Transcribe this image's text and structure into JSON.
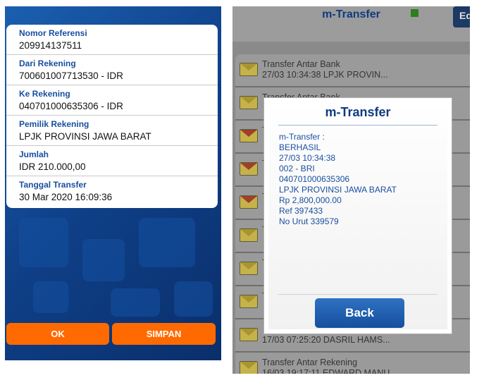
{
  "left_screen": {
    "fields": [
      {
        "label": "Nomor Referensi",
        "value": "209914137511"
      },
      {
        "label": "Dari Rekening",
        "value": "700601007713530 - IDR"
      },
      {
        "label": "Ke Rekening",
        "value": "040701000635306 - IDR"
      },
      {
        "label": "Pemilik Rekening",
        "value": "LPJK PROVINSI JAWA BARAT"
      },
      {
        "label": "Jumlah",
        "value": "IDR 210.000,00"
      },
      {
        "label": "Tanggal Transfer",
        "value": "30 Mar 2020 16:09:36"
      }
    ],
    "ok_label": "OK",
    "save_label": "SIMPAN",
    "colors": {
      "accent": "#ff6a00",
      "background": "#0f3f87",
      "label": "#1a4fa0"
    }
  },
  "right_screen": {
    "title": "m-Transfer",
    "edit_label": "Ed",
    "list": [
      {
        "title": "Transfer Antar Bank",
        "subtitle": "27/03 10:34:38 LPJK PROVIN...",
        "icon": "envelope-icon"
      },
      {
        "title": "Transfer Antar Bank",
        "subtitle": "",
        "icon": "envelope-icon"
      },
      {
        "title": "T",
        "subtitle": "",
        "icon": "envelope-red-icon"
      },
      {
        "title": "T",
        "subtitle": "",
        "icon": "envelope-red-icon"
      },
      {
        "title": "T",
        "subtitle": "",
        "icon": "envelope-red-icon"
      },
      {
        "title": "T",
        "subtitle": "",
        "icon": "envelope-icon"
      },
      {
        "title": "T",
        "subtitle": "",
        "icon": "envelope-icon"
      },
      {
        "title": "T",
        "subtitle": "",
        "icon": "envelope-icon"
      },
      {
        "title": "",
        "subtitle": "17/03 07:25:20 DASRIL HAMS...",
        "icon": "envelope-icon"
      },
      {
        "title": "Transfer Antar Rekening",
        "subtitle": "16/03 19:17:11 EDWARD MANU...",
        "icon": "envelope-icon"
      }
    ],
    "dialog": {
      "title": "m-Transfer",
      "lines": [
        "m-Transfer :",
        "BERHASIL",
        "27/03 10:34:38",
        "002 - BRI",
        "040701000635306",
        "LPJK PROVINSI JAWA BARAT",
        "Rp 2,800,000.00",
        "Ref 397433",
        "No Urut 339579"
      ],
      "back_label": "Back"
    }
  }
}
